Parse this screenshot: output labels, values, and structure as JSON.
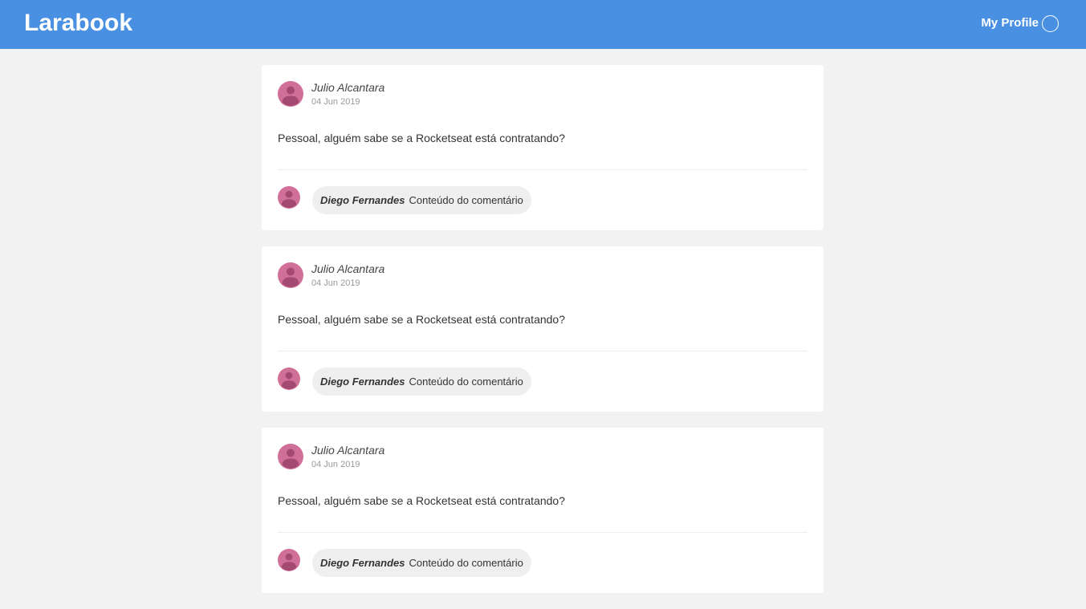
{
  "header": {
    "logo": "Larabook",
    "profile_label": "My Profile"
  },
  "colors": {
    "header_bg": "#4a90e2",
    "avatar": "#d07098",
    "page_bg": "#f2f2f2"
  },
  "posts": [
    {
      "author": "Julio Alcantara",
      "date": "04 Jun 2019",
      "content": "Pessoal, alguém sabe se a Rocketseat está contratando?",
      "comments": [
        {
          "author": "Diego Fernandes",
          "text": "Conteúdo do comentário"
        }
      ]
    },
    {
      "author": "Julio Alcantara",
      "date": "04 Jun 2019",
      "content": "Pessoal, alguém sabe se a Rocketseat está contratando?",
      "comments": [
        {
          "author": "Diego Fernandes",
          "text": "Conteúdo do comentário"
        }
      ]
    },
    {
      "author": "Julio Alcantara",
      "date": "04 Jun 2019",
      "content": "Pessoal, alguém sabe se a Rocketseat está contratando?",
      "comments": [
        {
          "author": "Diego Fernandes",
          "text": "Conteúdo do comentário"
        }
      ]
    }
  ]
}
